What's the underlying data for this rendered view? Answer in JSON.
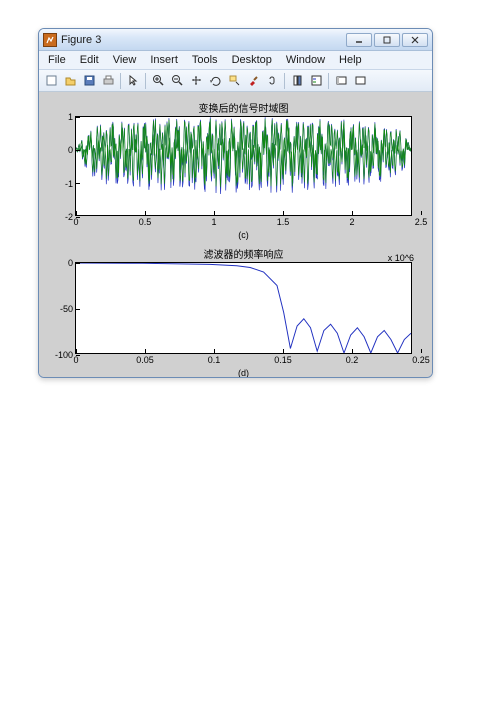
{
  "window": {
    "title": "Figure 3"
  },
  "menu": {
    "items": [
      "File",
      "Edit",
      "View",
      "Insert",
      "Tools",
      "Desktop",
      "Window",
      "Help"
    ]
  },
  "chart_data": [
    {
      "type": "line",
      "title": "变换后的信号时域图",
      "xlabel": "(c)",
      "ylabel": "",
      "xlim": [
        0,
        2500000.0
      ],
      "ylim": [
        -2,
        1
      ],
      "xticks": [
        0,
        0.5,
        1,
        1.5,
        2,
        2.5
      ],
      "xtick_exp": "x 10^6",
      "yticks": [
        -2,
        -1,
        0,
        1
      ],
      "series": [
        {
          "name": "signal-blue",
          "color": "#2030c0",
          "description": "dense amplitude-modulated oscillation ~[-1.4,1], envelope visible behind green"
        },
        {
          "name": "signal-green",
          "color": "#118a11",
          "description": "dense amplitude-modulated oscillation filling roughly [-1,1] between x≈0.05e6 and x≈2.45e6"
        }
      ],
      "envelope_samples": {
        "x": [
          0,
          0.1,
          0.25,
          0.5,
          0.75,
          1.0,
          1.25,
          1.5,
          1.75,
          2.0,
          2.25,
          2.45,
          2.5
        ],
        "upper": [
          0.05,
          0.6,
          0.85,
          0.9,
          0.95,
          0.95,
          0.95,
          0.95,
          0.9,
          0.88,
          0.8,
          0.55,
          0.05
        ],
        "lower": [
          0.0,
          -0.7,
          -0.95,
          -1.05,
          -1.1,
          -1.15,
          -1.15,
          -1.15,
          -1.1,
          -1.0,
          -0.9,
          -0.6,
          0.0
        ]
      }
    },
    {
      "type": "line",
      "title": "滤波器的频率响应",
      "xlabel": "(d)",
      "ylabel": "",
      "xlim": [
        0,
        0.25
      ],
      "ylim": [
        -100,
        0
      ],
      "xticks": [
        0,
        0.05,
        0.1,
        0.15,
        0.2,
        0.25
      ],
      "yticks": [
        -100,
        -50,
        0
      ],
      "series": [
        {
          "name": "magnitude",
          "color": "#2030c0",
          "x": [
            0,
            0.05,
            0.1,
            0.12,
            0.13,
            0.14,
            0.15,
            0.155,
            0.16,
            0.165,
            0.17,
            0.175,
            0.18,
            0.185,
            0.19,
            0.195,
            0.2,
            0.205,
            0.21,
            0.215,
            0.22,
            0.225,
            0.23,
            0.235,
            0.24,
            0.245,
            0.25
          ],
          "y": [
            0,
            -0.3,
            -1.5,
            -3,
            -5,
            -10,
            -25,
            -55,
            -95,
            -70,
            -62,
            -72,
            -98,
            -75,
            -68,
            -78,
            -100,
            -80,
            -72,
            -82,
            -100,
            -82,
            -75,
            -85,
            -100,
            -85,
            -78
          ]
        }
      ]
    }
  ]
}
